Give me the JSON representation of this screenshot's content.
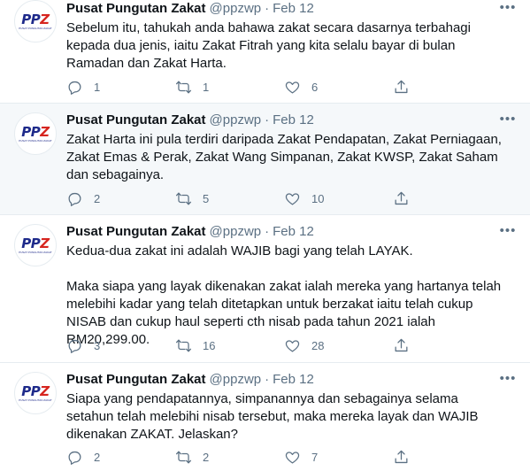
{
  "tweets": [
    {
      "author": "Pusat Pungutan Zakat",
      "handle": "@ppzwp",
      "separator": "·",
      "date": "Feb 12",
      "text": "Sebelum itu, tahukah anda bahawa zakat secara dasarnya terbahagi kepada dua jenis, iaitu Zakat Fitrah yang kita selalu bayar di bulan Ramadan dan Zakat Harta.",
      "replies": "1",
      "retweets": "1",
      "likes": "6"
    },
    {
      "author": "Pusat Pungutan Zakat",
      "handle": "@ppzwp",
      "separator": "·",
      "date": "Feb 12",
      "text": "Zakat Harta ini pula terdiri daripada Zakat Pendapatan, Zakat Perniagaan, Zakat Emas & Perak, Zakat Wang Simpanan, Zakat KWSP, Zakat Saham dan sebagainya.",
      "replies": "2",
      "retweets": "5",
      "likes": "10"
    },
    {
      "author": "Pusat Pungutan Zakat",
      "handle": "@ppzwp",
      "separator": "·",
      "date": "Feb 12",
      "text": "Kedua-dua zakat ini adalah WAJIB bagi yang telah LAYAK.\n\nMaka siapa yang layak dikenakan zakat ialah mereka yang hartanya telah melebihi kadar yang telah ditetapkan untuk berzakat iaitu telah cukup NISAB dan cukup haul seperti cth nisab pada tahun 2021 ialah RM20,299.00.",
      "replies": "3",
      "retweets": "16",
      "likes": "28"
    },
    {
      "author": "Pusat Pungutan Zakat",
      "handle": "@ppzwp",
      "separator": "·",
      "date": "Feb 12",
      "text": "Siapa yang pendapatannya, simpanannya dan sebagainya selama setahun telah melebihi nisab tersebut, maka mereka layak dan WAJIB dikenakan ZAKAT. Jelaskan?",
      "replies": "2",
      "retweets": "2",
      "likes": "7"
    }
  ],
  "avatar": {
    "logo": "PPZ",
    "tagline": "PUSAT PUNGUTAN ZAKAT"
  },
  "icons": {
    "reply": "reply-icon",
    "retweet": "retweet-icon",
    "like": "heart-icon",
    "share": "share-icon",
    "more": "more-icon"
  },
  "colors": {
    "text": "#0f1419",
    "muted": "#5b7083",
    "border": "#e6ecf0",
    "highlight": "#f5f8fa",
    "logo_blue": "#1e2a8a",
    "logo_red": "#d6251f"
  }
}
